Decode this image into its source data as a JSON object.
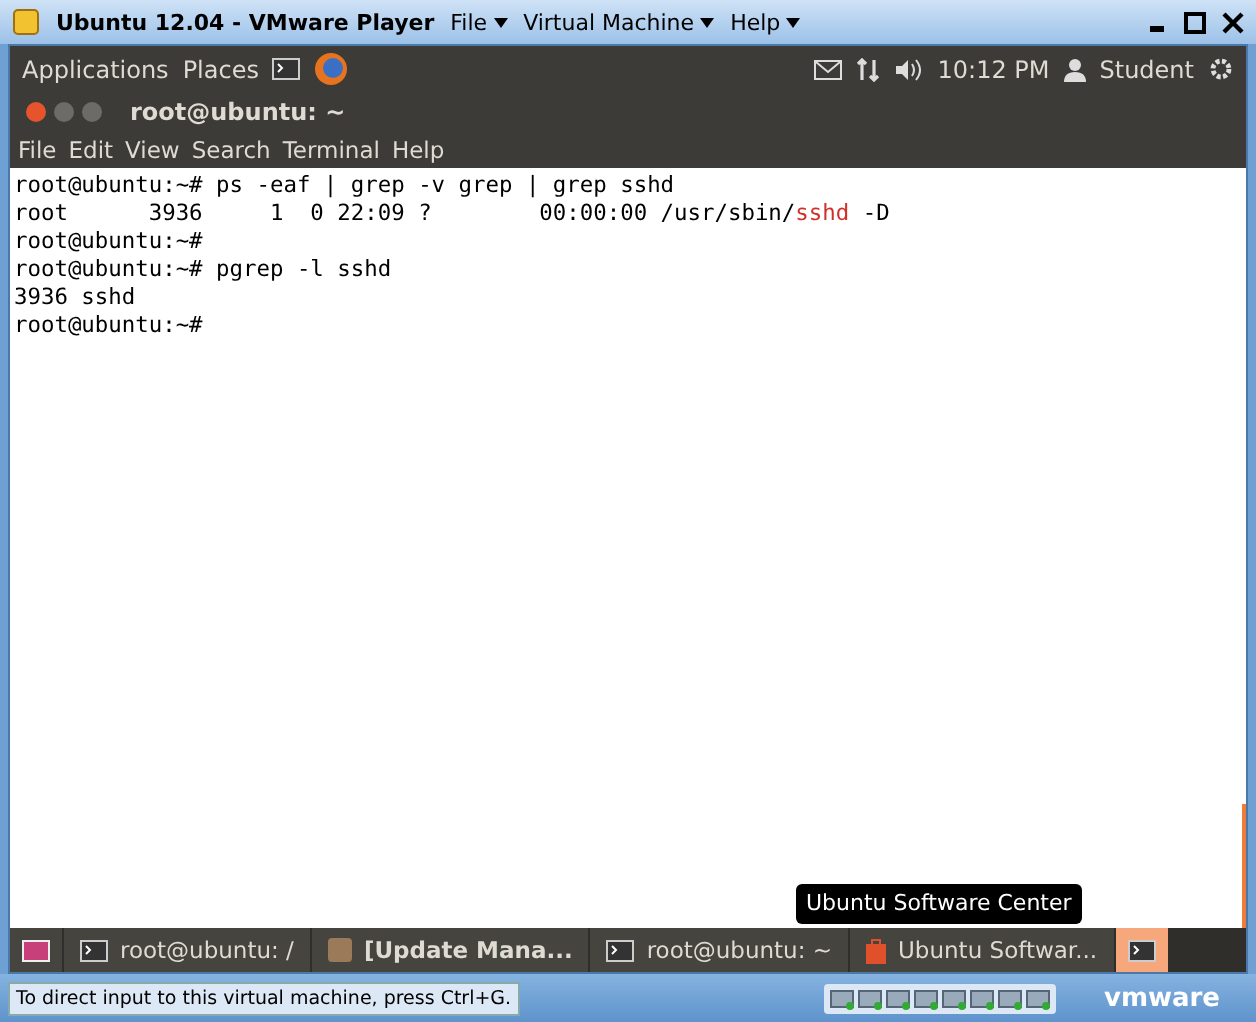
{
  "window": {
    "title": "Ubuntu 12.04 - VMware Player",
    "menus": [
      "File",
      "Virtual Machine",
      "Help"
    ]
  },
  "top_panel": {
    "menus": [
      "Applications",
      "Places"
    ],
    "clock": "10:12 PM",
    "user": "Student"
  },
  "terminal": {
    "title": "root@ubuntu: ~",
    "menus": [
      "File",
      "Edit",
      "View",
      "Search",
      "Terminal",
      "Help"
    ],
    "lines": [
      [
        {
          "text": "root@ubuntu:~# ps -eaf | grep -v grep | grep sshd",
          "kind": "plain"
        }
      ],
      [
        {
          "text": "root      3936     1  0 22:09 ?        00:00:00 /usr/sbin/",
          "kind": "plain"
        },
        {
          "text": "sshd",
          "kind": "match"
        },
        {
          "text": " -D",
          "kind": "plain"
        }
      ],
      [
        {
          "text": "root@ubuntu:~#",
          "kind": "plain"
        }
      ],
      [
        {
          "text": "root@ubuntu:~# pgrep -l sshd",
          "kind": "plain"
        }
      ],
      [
        {
          "text": "3936 sshd",
          "kind": "plain"
        }
      ],
      [
        {
          "text": "root@ubuntu:~#",
          "kind": "plain"
        }
      ]
    ]
  },
  "tooltip": "Ubuntu Software Center",
  "taskbar": [
    {
      "kind": "desktop",
      "selected": false
    },
    {
      "kind": "terminal",
      "label": "root@ubuntu: /",
      "urgent": false,
      "selected": false
    },
    {
      "kind": "updater",
      "label": "[Update Mana...",
      "urgent": true,
      "selected": false
    },
    {
      "kind": "terminal",
      "label": "root@ubuntu: ~",
      "urgent": false,
      "selected": false
    },
    {
      "kind": "software",
      "label": "Ubuntu Softwar...",
      "urgent": false,
      "selected": false
    },
    {
      "kind": "terminal",
      "selected": true
    }
  ],
  "status_bar": {
    "hint": "To direct input to this virtual machine, press Ctrl+G.",
    "logo": "vmware"
  }
}
